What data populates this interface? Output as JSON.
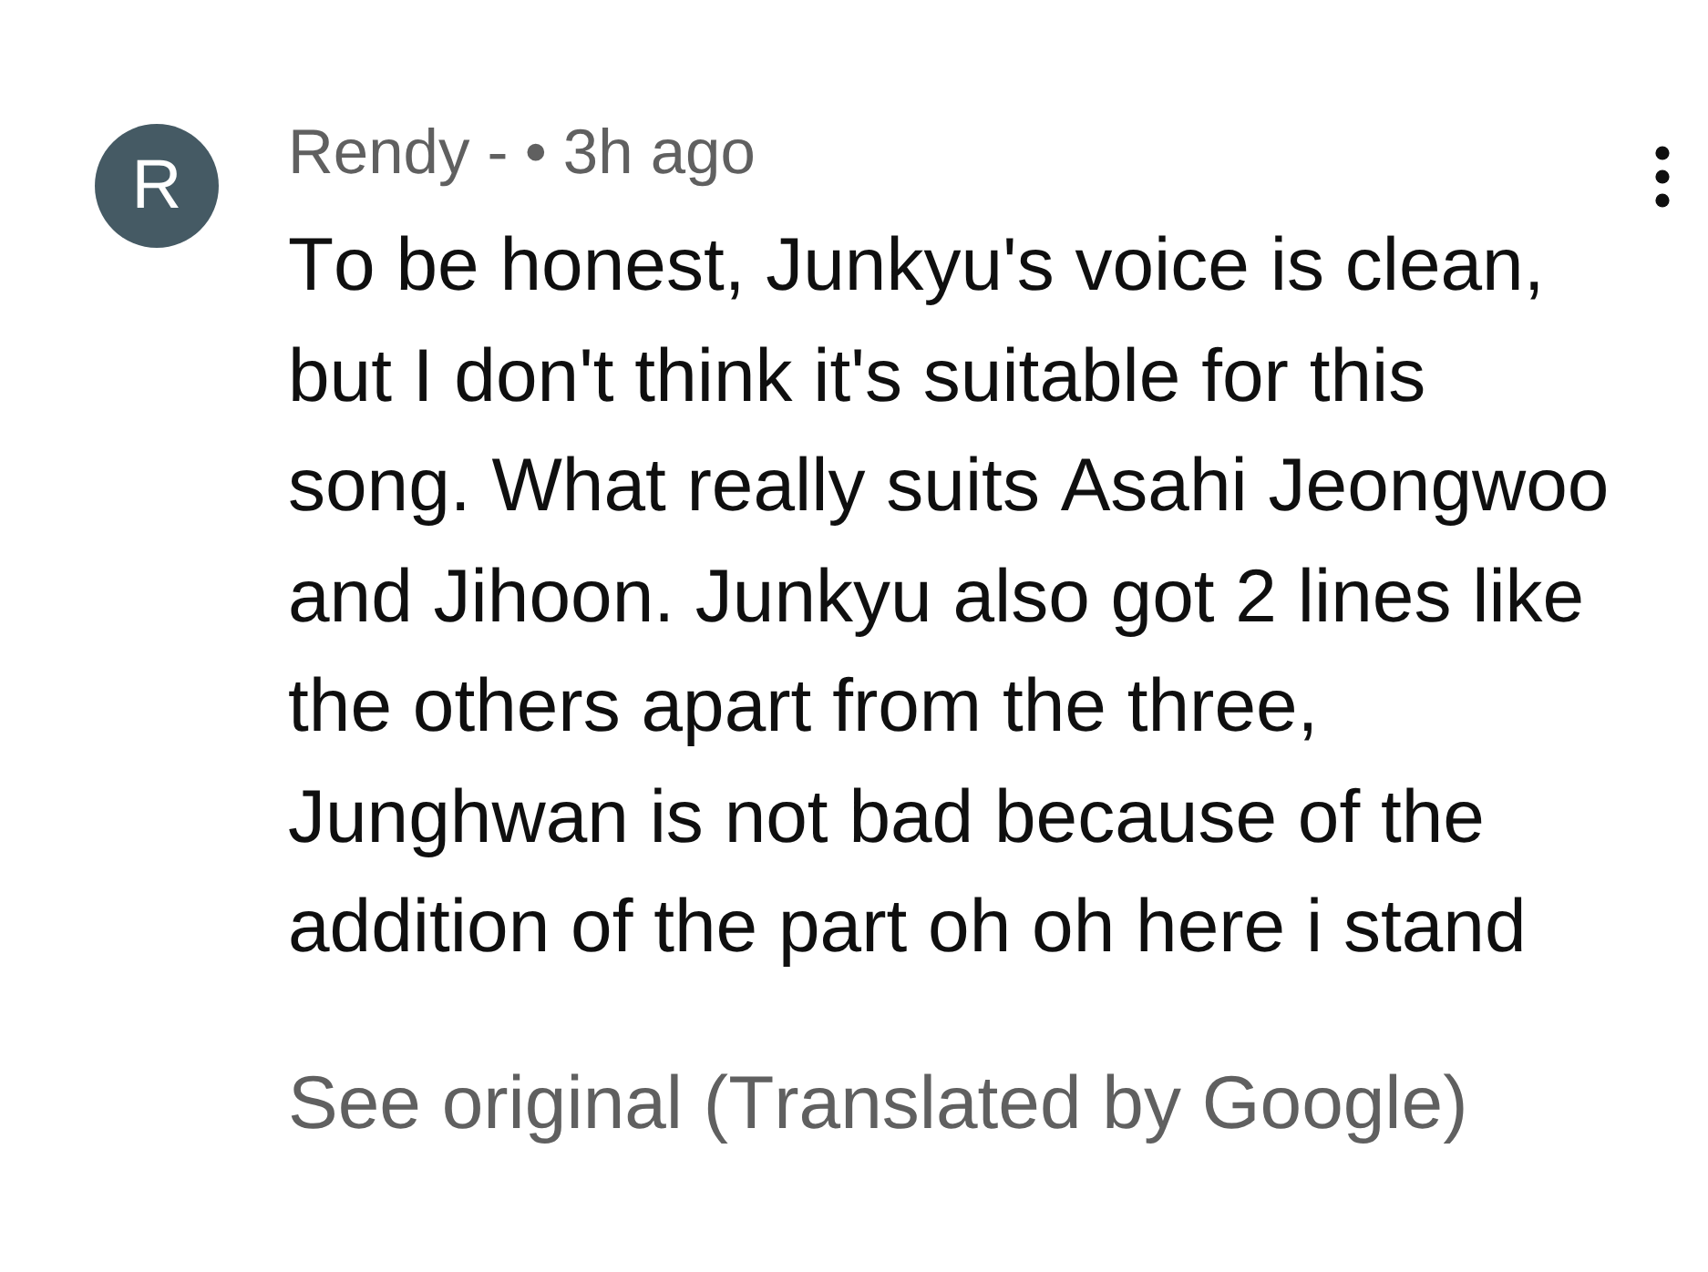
{
  "comment": {
    "avatar_letter": "R",
    "author": "Rendy -",
    "separator": "•",
    "time": "3h ago",
    "text": "To be honest, Junkyu's voice is clean, but I don't think it's suitable for this song. What really suits Asahi Jeongwoo and Jihoon. Junkyu also got 2 lines like the others apart from the three, Junghwan is not bad because of the addition of the part oh oh here i stand",
    "translation_link": "See original (Translated by Google)"
  }
}
